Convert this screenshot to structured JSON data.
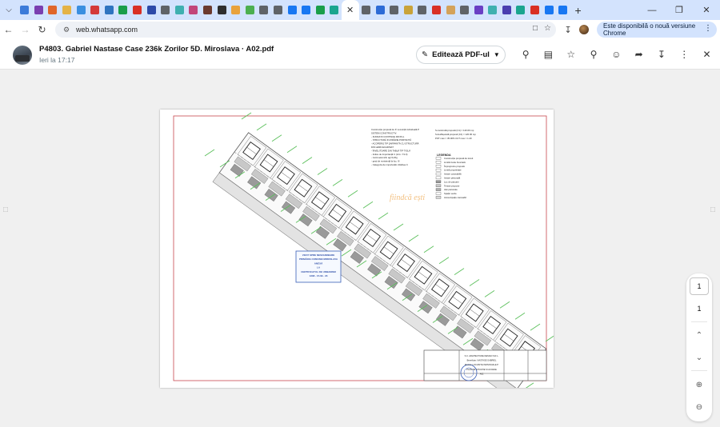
{
  "browser": {
    "tab_favicons": [
      "#3c7bd9",
      "#7a3fb0",
      "#e0662b",
      "#e4b347",
      "#3a8fe0",
      "#d43a3a",
      "#2f74c0",
      "#1a9e4a",
      "#d93025",
      "#2d4aa8",
      "#5f6368",
      "#3fb0b0",
      "#c2457a",
      "#6b3a2e",
      "#2e2e2e",
      "#e9a23b",
      "#4caf50",
      "#5f6368",
      "#5f6368",
      "#1877f2",
      "#1877f2",
      "#1a9e4a",
      "#1aa58f",
      "#5f6368",
      "#2d6bd6",
      "#5f6368",
      "#c9a33a",
      "#5f6368",
      "#d93025",
      "#d4a25a",
      "#5f6368",
      "#6a3fc4",
      "#3fb0b0",
      "#4a3fb0",
      "#1aa58f",
      "#d93025",
      "#1877f2",
      "#1877f2"
    ],
    "url": "web.whatsapp.com",
    "update_label": "Este disponibilă o nouă versiune Chrome"
  },
  "viewer": {
    "title": "P4803. Gabriel Nastase Case 236k Zorilor 5D. Miroslava · A02.pdf",
    "timestamp": "Ieri la 17:17",
    "edit_label": "Editează PDF-ul",
    "current_page": "1",
    "total_pages": "1"
  },
  "plan": {
    "stamp_lines": [
      "VIZAT SPRE NESCHIMBARE",
      "PRIMĂRIA COMUNEI MIROSLAVA",
      "ANEXĂ",
      "LA",
      "CERTIFICATUL DE URBANISM",
      "1338 · 15.09 · 23"
    ],
    "watermark": "fiindcă ești",
    "legend_title": "LEGENDA",
    "legend_items": [
      "Construcție propusă de locuit",
      "Limită Carte Funciară",
      "Împrejmuire propusă",
      "Limită proprietate",
      "Intrare carosabilă",
      "Intrare pietonală",
      "Loc de parcare",
      "Terase propuse",
      "Alei pietonale",
      "Spațiu verde",
      "Acces/spațiu carosabil"
    ],
    "notes_left": [
      "Construcție propusă de P, Locuință individuală P",
      "SISTEM CONSTRUCTIV:",
      "- FUNDAȚII CONTINUE DIN B.A.",
      "- STRUCTURĂ IN ZIDĂRIE PORTANTĂ",
      "- ACOPERIȘ TIP ȘARPANTĂ CU STRUCTURĂ",
      "DIN LEMN ECARISAT",
      "- ÎNVELITOARE DIN TABLĂ TIP TIGLĂ",
      "- Indice de Importanță C (H.G. 7/1.0)",
      "- zonă seismică: ag=0,20g",
      "- grad de rezistență la foc: III",
      "- Categoria de importanță: clădirea C"
    ],
    "notes_right": [
      "S.construită propusă (C1) = 120.00 mp",
      "S.desfășurată propusă (C1) = 120.00 mp",
      "POT max = 35.00%   CUT max = 1.20"
    ],
    "titleblock_lines": [
      "S.C. ARHITECTURE DESIGN S.R.L.",
      "Beneficiar: NASTASE GABRIEL",
      "Proiect: LOCUINTE INDIVIDUALE P",
      "PLAN DE SITUATIE SI ACCESE",
      "A02"
    ]
  }
}
